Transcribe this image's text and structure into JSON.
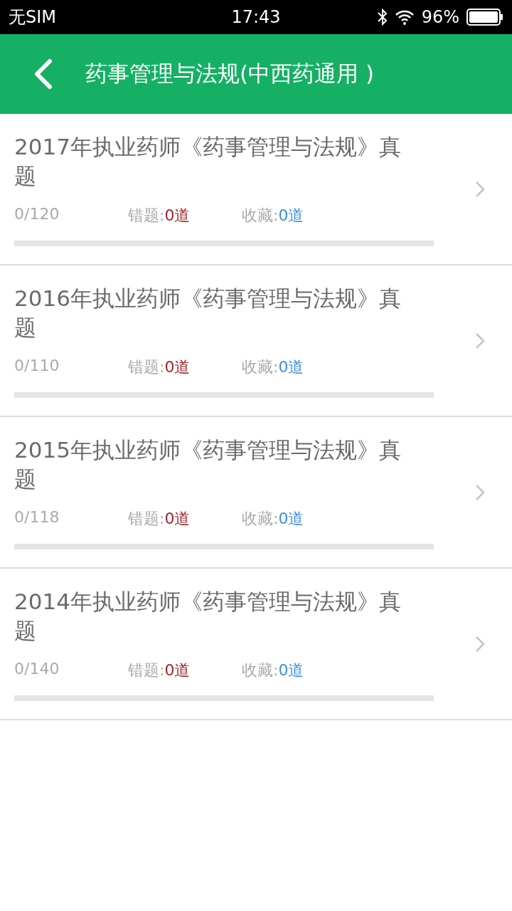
{
  "status_bar": {
    "carrier": "无SIM",
    "time": "17:43",
    "battery": "96%"
  },
  "header": {
    "title": "药事管理与法规(中西药通用 )"
  },
  "papers": [
    {
      "title": "2017年执业药师《药事管理与法规》真题",
      "progress": "0/120",
      "wrong_label": "错题:",
      "wrong_count": "0道",
      "fav_label": "收藏:",
      "fav_count": "0道",
      "level": 0
    },
    {
      "title": "2016年执业药师《药事管理与法规》真题",
      "progress": "0/110",
      "wrong_label": "错题:",
      "wrong_count": "0道",
      "fav_label": "收藏:",
      "fav_count": "0道",
      "level": 0
    },
    {
      "title": "2015年执业药师《药事管理与法规》真题",
      "progress": "0/118",
      "wrong_label": "错题:",
      "wrong_count": "0道",
      "fav_label": "收藏:",
      "fav_count": "0道",
      "level": 0
    },
    {
      "title": "2014年执业药师《药事管理与法规》真题",
      "progress": "0/140",
      "wrong_label": "错题:",
      "wrong_count": "0道",
      "fav_label": "收藏:",
      "fav_count": "0道",
      "level": 0
    }
  ]
}
